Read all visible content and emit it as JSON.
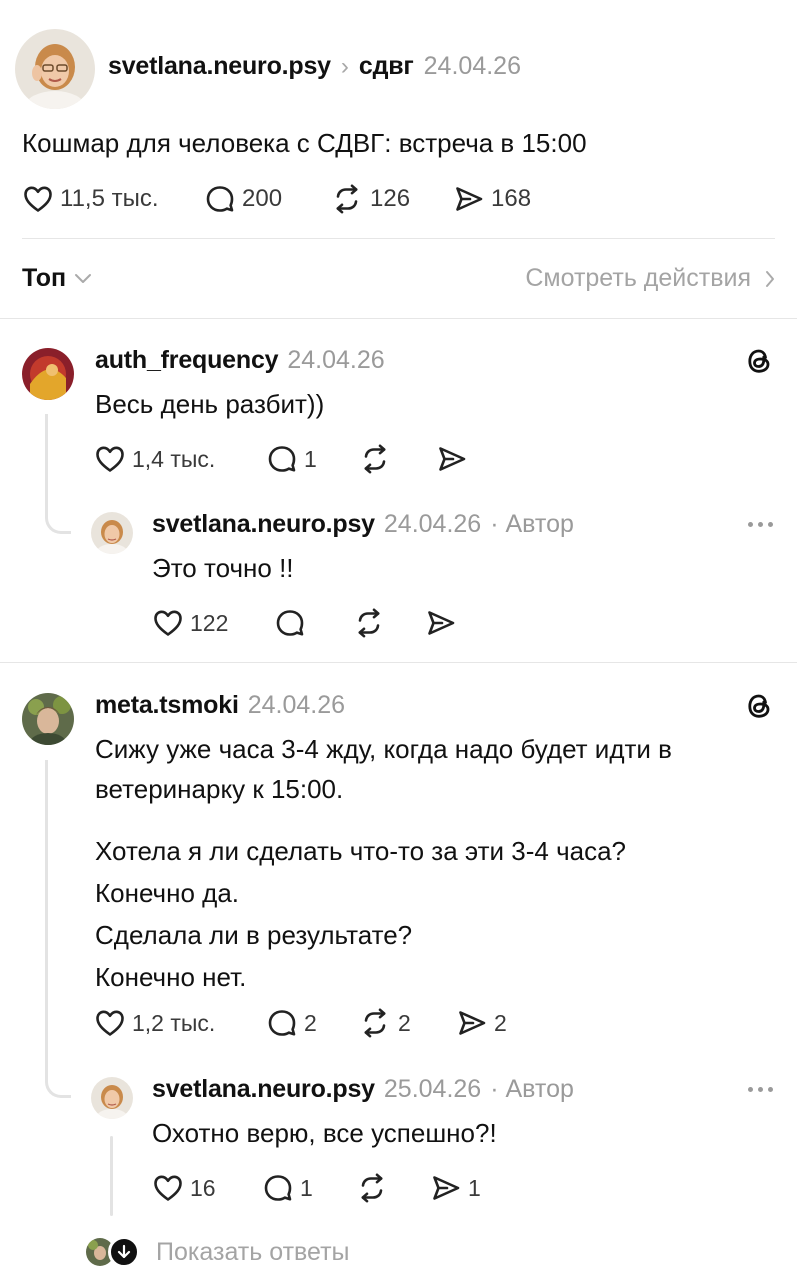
{
  "post": {
    "author": "svetlana.neuro.psy",
    "chevron": "›",
    "topic": "сдвг",
    "date": "24.04.26",
    "text": "Кошмар для человека с СДВГ: встреча в 15:00",
    "likes": "11,5 тыс.",
    "comments": "200",
    "reposts": "126",
    "shares": "168"
  },
  "sort_bar": {
    "sort_label": "Топ",
    "view_activity": "Смотреть действия"
  },
  "comments": [
    {
      "author": "auth_frequency",
      "date": "24.04.26",
      "text": "Весь день разбит))",
      "likes": "1,4 тыс.",
      "comments": "1",
      "reply": {
        "author": "svetlana.neuro.psy",
        "date": "24.04.26",
        "author_badge": "· Автор",
        "text": "Это точно !!",
        "likes": "122"
      }
    },
    {
      "author": "meta.tsmoki",
      "date": "24.04.26",
      "text_lines": [
        "Сижу уже часа 3-4 жду, когда надо будет идти в",
        "ветеринарку к 15:00.",
        "Хотела я ли сделать что-то за эти 3-4 часа?",
        "Конечно да.",
        "Сделала ли в результате?",
        "Конечно нет."
      ],
      "likes": "1,2 тыс.",
      "comments": "2",
      "reposts": "2",
      "shares": "2",
      "reply": {
        "author": "svetlana.neuro.psy",
        "date": "25.04.26",
        "author_badge": "· Автор",
        "text": "Охотно верю, все успешно?!",
        "likes": "16",
        "comments": "1",
        "shares": "1"
      }
    }
  ],
  "show_replies": "Показать ответы",
  "icons": {
    "like": "heart-icon",
    "comment": "speech-bubble-icon",
    "repost": "repost-arrows-icon",
    "share": "send-icon",
    "threads": "threads-logo-icon",
    "more": "more-dots-icon"
  }
}
